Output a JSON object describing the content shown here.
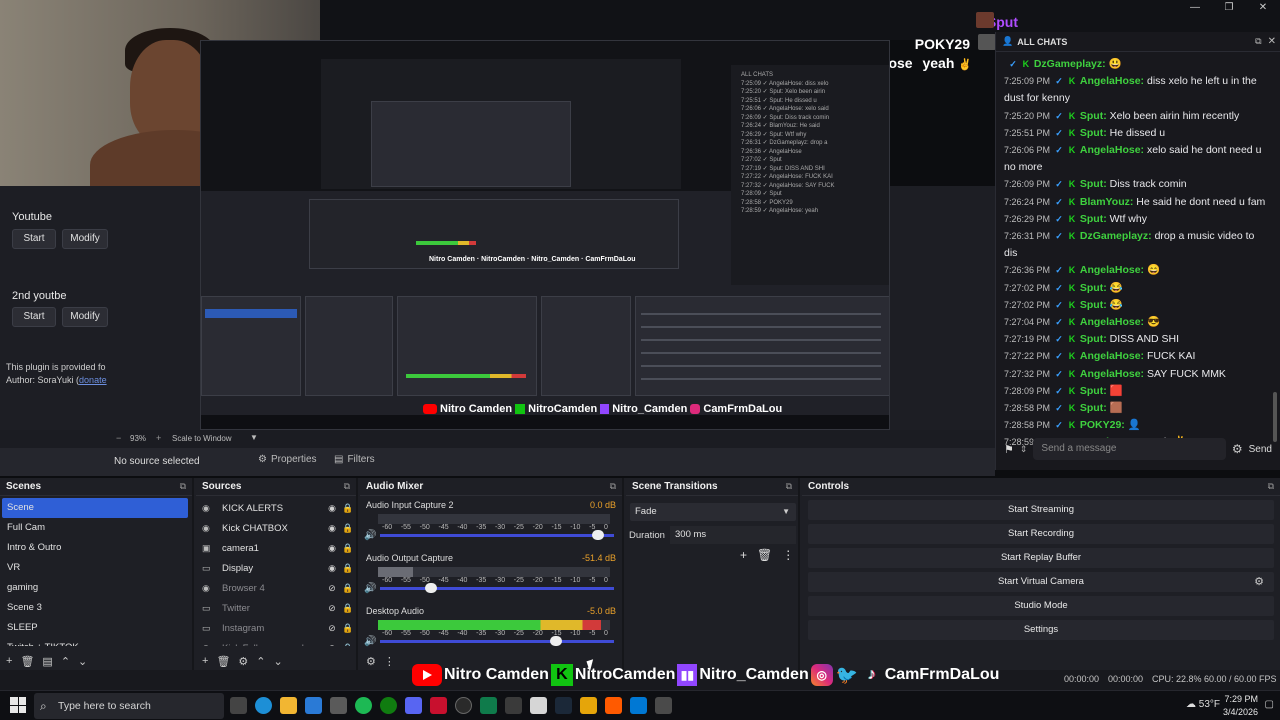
{
  "overlay_top": {
    "lines": [
      {
        "name": "Sput",
        "color": "#b04dff"
      },
      {
        "name": "POKY29",
        "color": "#ffffff"
      },
      {
        "name": "AngelaHose",
        "color": "#ffffff",
        "text": "yeah",
        "emoji": "✌"
      }
    ]
  },
  "chat": {
    "header": "ALL CHATS",
    "messages": [
      {
        "time": "",
        "name": "DzGameplayz:",
        "text": "",
        "emoji": "😃"
      },
      {
        "time": "7:25:09 PM",
        "name": "AngelaHose:",
        "text": "diss xelo he left u in the dust for kenny"
      },
      {
        "time": "7:25:20 PM",
        "name": "Sput:",
        "text": "Xelo been airin him recently"
      },
      {
        "time": "7:25:51 PM",
        "name": "Sput:",
        "text": "He dissed u"
      },
      {
        "time": "7:26:06 PM",
        "name": "AngelaHose:",
        "text": "xelo said he dont need u no more"
      },
      {
        "time": "7:26:09 PM",
        "name": "Sput:",
        "text": "Diss track comin"
      },
      {
        "time": "7:26:24 PM",
        "name": "BlamYouz:",
        "text": "He said he dont need u fam"
      },
      {
        "time": "7:26:29 PM",
        "name": "Sput:",
        "text": "Wtf why"
      },
      {
        "time": "7:26:31 PM",
        "name": "DzGameplayz:",
        "text": "drop a music video to dis"
      },
      {
        "time": "7:26:36 PM",
        "name": "AngelaHose:",
        "text": "",
        "emoji": "😄"
      },
      {
        "time": "7:27:02 PM",
        "name": "Sput:",
        "text": "",
        "emoji": "😂"
      },
      {
        "time": "7:27:02 PM",
        "name": "Sput:",
        "text": "",
        "emoji": "😂"
      },
      {
        "time": "7:27:04 PM",
        "name": "AngelaHose:",
        "text": "",
        "emoji": "😎"
      },
      {
        "time": "7:27:19 PM",
        "name": "Sput:",
        "text": "DISS AND SHI"
      },
      {
        "time": "7:27:22 PM",
        "name": "AngelaHose:",
        "text": "FUCK KAI"
      },
      {
        "time": "7:27:32 PM",
        "name": "AngelaHose:",
        "text": "SAY FUCK MMK"
      },
      {
        "time": "7:28:09 PM",
        "name": "Sput:",
        "text": "",
        "emoji": "🟥"
      },
      {
        "time": "7:28:58 PM",
        "name": "Sput:",
        "text": "",
        "emoji": "🟫"
      },
      {
        "time": "7:28:58 PM",
        "name": "POKY29:",
        "text": "",
        "emoji": "👤"
      },
      {
        "time": "7:28:59 PM",
        "name": "AngelaHose:",
        "text": "yeah",
        "emoji": "✌"
      }
    ],
    "input_placeholder": "Send a message",
    "send_label": "Send"
  },
  "plugin": {
    "sections": [
      {
        "title": "Youtube",
        "start": "Start",
        "modify": "Modify"
      },
      {
        "title": "2nd youtbe",
        "start": "Start",
        "modify": "Modify"
      }
    ],
    "note1": "This plugin is provided fo",
    "note2_prefix": "Author: SoraYuki (",
    "note2_link": "donate"
  },
  "zoom": {
    "percent": "93%",
    "mode": "Scale to Window"
  },
  "props": {
    "no_source": "No source selected",
    "properties": "Properties",
    "filters": "Filters"
  },
  "scenes": {
    "title": "Scenes",
    "items": [
      "Scene",
      "Full Cam",
      "Intro & Outro",
      "VR",
      "gaming",
      "Scene 3",
      "SLEEP",
      "Twitch + TIKTOK"
    ]
  },
  "sources": {
    "title": "Sources",
    "items": [
      {
        "name": "KICK ALERTS",
        "icon": "globe-icon",
        "glyph": "◉",
        "visible": true
      },
      {
        "name": "Kick CHATBOX",
        "icon": "globe-icon",
        "glyph": "◉",
        "visible": true
      },
      {
        "name": "camera1",
        "icon": "camera-icon",
        "glyph": "▣",
        "visible": true
      },
      {
        "name": "Display",
        "icon": "monitor-icon",
        "glyph": "▭",
        "visible": true
      },
      {
        "name": "Browser 4",
        "icon": "globe-icon",
        "glyph": "◉",
        "visible": false
      },
      {
        "name": "Twitter",
        "icon": "window-icon",
        "glyph": "▭",
        "visible": false
      },
      {
        "name": "Instagram",
        "icon": "window-icon",
        "glyph": "▭",
        "visible": false
      },
      {
        "name": "Kick Followers goal",
        "icon": "globe-icon",
        "glyph": "◉",
        "visible": false
      }
    ]
  },
  "mixer": {
    "title": "Audio Mixer",
    "ticks": [
      "-60",
      "-55",
      "-50",
      "-45",
      "-40",
      "-35",
      "-30",
      "-25",
      "-20",
      "-15",
      "-10",
      "-5",
      "0"
    ],
    "channels": [
      {
        "name": "Audio Input Capture 2",
        "db": "0.0 dB",
        "level": 0.0,
        "volume": 0.93
      },
      {
        "name": "Audio Output Capture",
        "db": "-51.4 dB",
        "level": 0.15,
        "volume": 0.22
      },
      {
        "name": "Desktop Audio",
        "db": "-5.0 dB",
        "level": 0.96,
        "volume": 0.75
      }
    ]
  },
  "transitions": {
    "title": "Scene Transitions",
    "selected": "Fade",
    "duration_label": "Duration",
    "duration_value": "300 ms"
  },
  "controls": {
    "title": "Controls",
    "buttons": [
      "Start Streaming",
      "Start Recording",
      "Start Replay Buffer",
      "Start Virtual Camera",
      "Studio Mode",
      "Settings"
    ]
  },
  "status": {
    "social": [
      "Nitro Camden",
      "NitroCamden",
      "Nitro_Camden",
      "CamFrmDaLou"
    ],
    "rec_time": "00:00:00",
    "stream_time": "00:00:00",
    "cpu": "CPU: 22.8%",
    "fps": "60.00 / 60.00 FPS"
  },
  "taskbar": {
    "search_placeholder": "Type here to search",
    "weather": "53°F",
    "time": "7:29 PM",
    "date": "3/4/2026"
  },
  "colors": {
    "accent": "#2f5fd6",
    "kick": "#11c411",
    "chat_name": "#3fd13f"
  }
}
